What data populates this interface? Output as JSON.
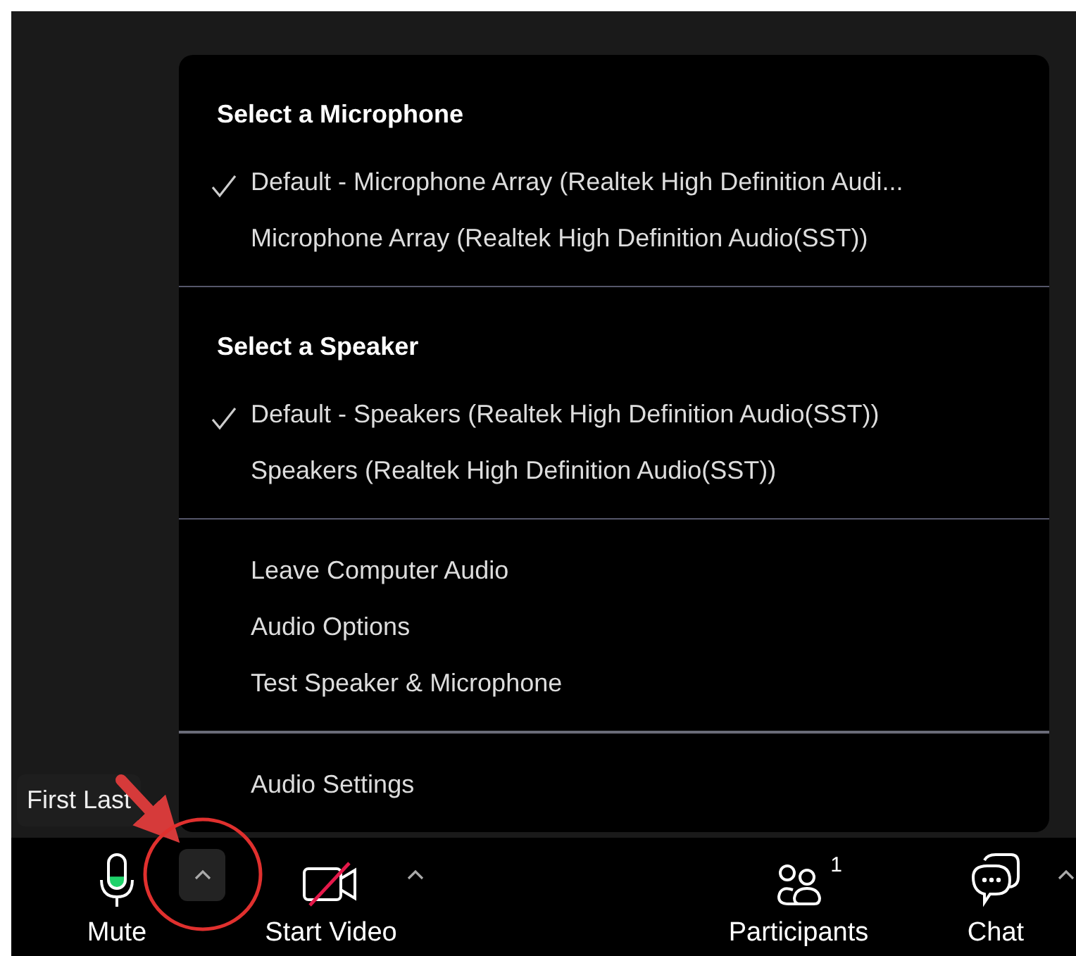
{
  "audio_menu": {
    "sections": [
      {
        "heading": "Select a Microphone",
        "items": [
          {
            "label": "Default - Microphone Array (Realtek High Definition Audi...",
            "checked": true
          },
          {
            "label": "Microphone Array (Realtek High Definition Audio(SST))",
            "checked": false
          }
        ]
      },
      {
        "heading": "Select a Speaker",
        "items": [
          {
            "label": "Default - Speakers (Realtek High Definition Audio(SST))",
            "checked": true
          },
          {
            "label": "Speakers (Realtek High Definition Audio(SST))",
            "checked": false
          }
        ]
      },
      {
        "items": [
          {
            "label": "Leave Computer Audio",
            "checked": false
          },
          {
            "label": "Audio Options",
            "checked": false
          },
          {
            "label": "Test Speaker & Microphone",
            "checked": false
          }
        ]
      },
      {
        "items": [
          {
            "label": "Audio Settings",
            "checked": false
          }
        ]
      }
    ]
  },
  "name_tooltip": {
    "text": "First Last"
  },
  "toolbar": {
    "buttons": [
      {
        "kind": "mic",
        "label": "Mute",
        "level": 0.35,
        "caret": {
          "open": true
        }
      },
      {
        "kind": "video",
        "label": "Start Video",
        "caret": {
          "open": false
        }
      },
      {
        "kind": "participants",
        "label": "Participants",
        "count": "1"
      },
      {
        "kind": "chat",
        "label": "Chat",
        "caret": {
          "open": false
        }
      }
    ]
  }
}
